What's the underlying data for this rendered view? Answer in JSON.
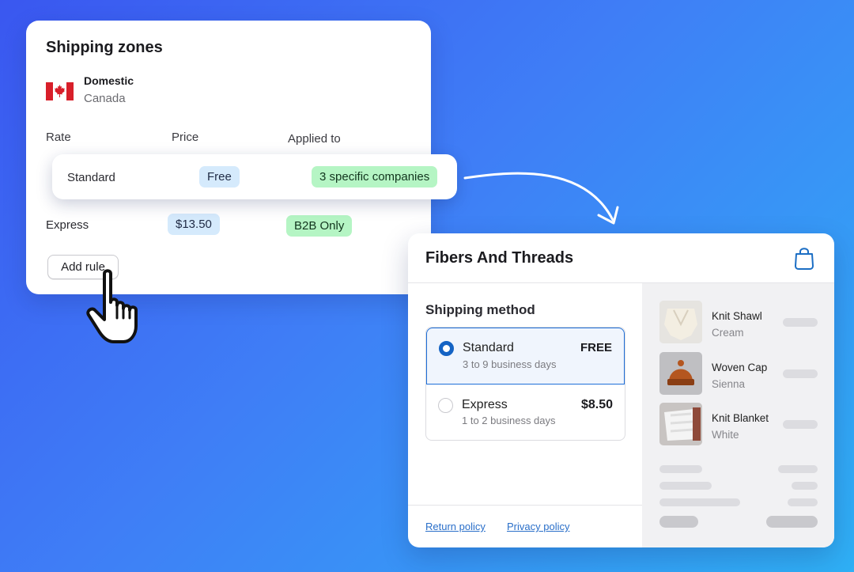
{
  "zones": {
    "title": "Shipping zones",
    "zone": {
      "name": "Domestic",
      "country": "Canada",
      "flag_icon": "canada-flag-icon"
    },
    "columns": {
      "rate": "Rate",
      "price": "Price",
      "applied_to": "Applied to"
    },
    "rows": [
      {
        "rate": "Standard",
        "price": "Free",
        "applied_to": "3 specific companies"
      },
      {
        "rate": "Express",
        "price": "$13.50",
        "applied_to": "B2B Only"
      }
    ],
    "add_rule_label": "Add rule"
  },
  "checkout": {
    "shop_name": "Fibers And Threads",
    "cart_icon": "shopping-bag-icon",
    "shipping_title": "Shipping method",
    "methods": [
      {
        "name": "Standard",
        "days": "3 to 9 business days",
        "price": "FREE",
        "selected": true
      },
      {
        "name": "Express",
        "days": "1 to 2 business days",
        "price": "$8.50",
        "selected": false
      }
    ],
    "policies": {
      "return": "Return policy",
      "privacy": "Privacy policy"
    },
    "items": [
      {
        "name": "Knit Shawl",
        "variant": "Cream"
      },
      {
        "name": "Woven Cap",
        "variant": "Sienna"
      },
      {
        "name": "Knit Blanket",
        "variant": "White"
      }
    ]
  },
  "colors": {
    "background_start": "#3a57f0",
    "background_end": "#2fb0f5",
    "price_pill": "#d5eafc",
    "applied_pill": "#b5f5c4",
    "selected_accent": "#1463c4",
    "link": "#2a6fc9"
  }
}
